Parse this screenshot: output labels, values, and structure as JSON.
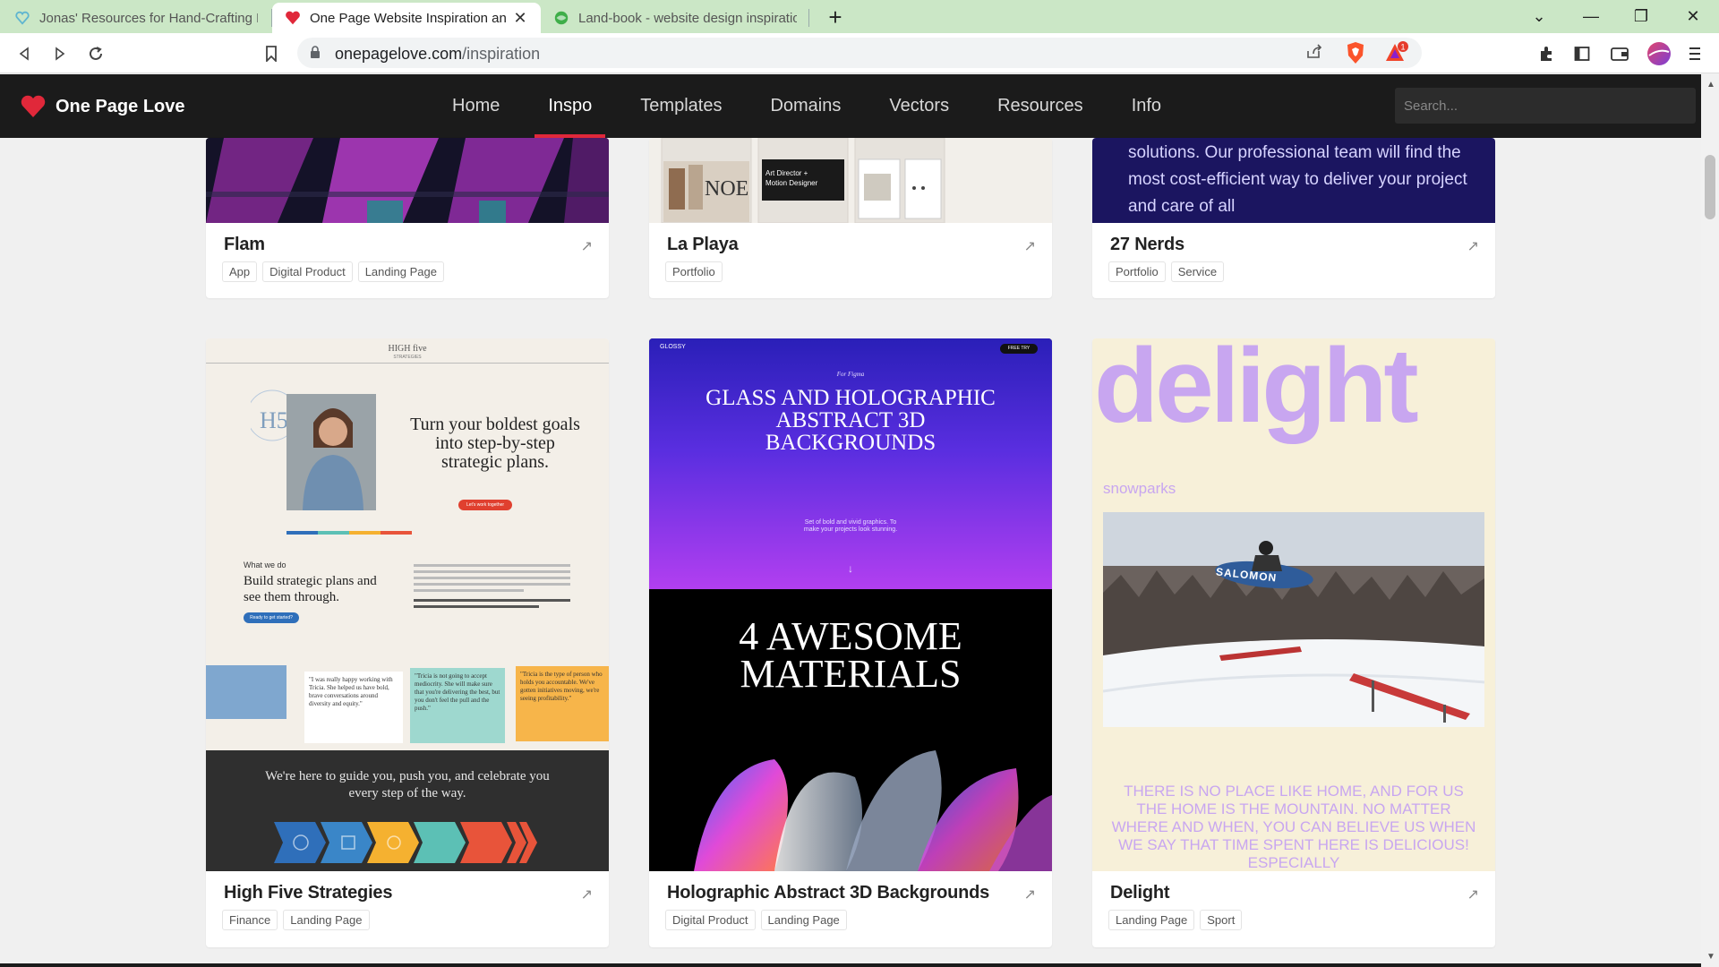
{
  "browser": {
    "tabs": [
      {
        "title": "Jonas' Resources for Hand-Crafting Be",
        "active": false,
        "icon": "heart-outline-icon"
      },
      {
        "title": "One Page Website Inspiration and",
        "active": true,
        "icon": "heart-icon"
      },
      {
        "title": "Land-book - website design inspiratio",
        "active": false,
        "icon": "landbook-icon"
      }
    ],
    "new_tab_label": "+",
    "window_controls": {
      "dropdown": "⌄",
      "minimize": "—",
      "restore": "❐",
      "close": "✕"
    },
    "url_host": "onepagelove.com",
    "url_path": "/inspiration",
    "rewards_badge": "1"
  },
  "site": {
    "logo_text": "One Page Love",
    "nav": [
      {
        "label": "Home",
        "active": false
      },
      {
        "label": "Inspo",
        "active": true
      },
      {
        "label": "Templates",
        "active": false
      },
      {
        "label": "Domains",
        "active": false
      },
      {
        "label": "Vectors",
        "active": false
      },
      {
        "label": "Resources",
        "active": false
      },
      {
        "label": "Info",
        "active": false
      }
    ],
    "search_placeholder": "Search...",
    "accent_color": "#e0283a"
  },
  "cards_top": [
    {
      "title": "Flam",
      "tags": [
        "App",
        "Digital Product",
        "Landing Page"
      ]
    },
    {
      "title": "La Playa",
      "tags": [
        "Portfolio"
      ],
      "preview_texts": [
        "NOE",
        "Art Director +",
        "Motion Designer"
      ]
    },
    {
      "title": "27 Nerds",
      "tags": [
        "Portfolio",
        "Service"
      ],
      "preview_text": "solutions. Our professional team will find the most cost-efficient way to deliver your project and care of all"
    }
  ],
  "cards_bottom": [
    {
      "title": "High Five Strategies",
      "tags": [
        "Finance",
        "Landing Page"
      ],
      "preview": {
        "brand": "HIGH five",
        "brand_sub": "STRATEGIES",
        "headline": "Turn your boldest goals into step-by-step strategic plans.",
        "cta": "Let's work together",
        "what_we_do": "What we do",
        "subhead": "Build strategic plans and see them through.",
        "cta2": "Ready to get started?",
        "quotes": [
          "\"I was really happy working with Tricia. She helped us have bold, brave conversations around diversity and equity.\"",
          "\"Tricia is not going to accept mediocrity. She will make sure that you're delivering the best, but you don't feel the pull and the push.\"",
          "\"Tricia is the type of person who holds you accountable. We've gotten initiatives moving, we're seeing profitability.\""
        ],
        "bottom_text": "We're here to guide you, push you, and celebrate you every step of the way."
      }
    },
    {
      "title": "Holographic Abstract 3D Backgrounds",
      "tags": [
        "Digital Product",
        "Landing Page"
      ],
      "preview": {
        "brand": "GLOSSY",
        "badge": "FREE TRY",
        "small": "For Figma",
        "headline": "GLASS AND HOLOGRAPHIC ABSTRACT 3D BACKGROUNDS",
        "desc": "Set of bold and vivid graphics. To make your projects look stunning.",
        "big": "4 AWESOME MATERIALS"
      }
    },
    {
      "title": "Delight",
      "tags": [
        "Landing Page",
        "Sport"
      ],
      "preview": {
        "big": "delight",
        "sub": "snowparks",
        "board_text": "SALOMON",
        "text": "THERE IS NO PLACE LIKE HOME, AND FOR US THE HOME IS THE MOUNTAIN. NO MATTER WHERE AND WHEN, YOU CAN BELIEVE US WHEN WE SAY THAT TIME SPENT HERE IS DELICIOUS! ESPECIALLY"
      }
    }
  ]
}
